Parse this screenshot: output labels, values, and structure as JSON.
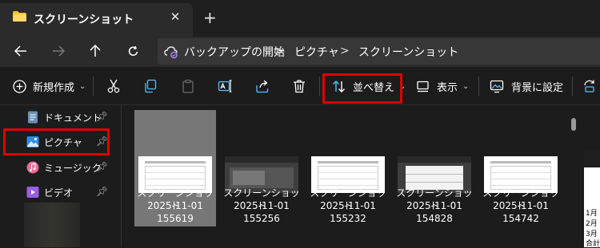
{
  "window": {
    "tab_title": "スクリーンショット",
    "close_symbol": "✕",
    "new_tab_symbol": "+"
  },
  "address_bar": {
    "breadcrumbs": [
      "バックアップの開始",
      "ピクチャ",
      "スクリーンショット"
    ],
    "separator": ">"
  },
  "command_bar": {
    "new_label": "新規作成",
    "sort_label": "並べ替え",
    "view_label": "表示",
    "set_background_label": "背景に設定"
  },
  "sidebar": {
    "items": [
      {
        "label": "ドキュメント",
        "icon": "document-icon"
      },
      {
        "label": "ピクチャ",
        "icon": "pictures-icon"
      },
      {
        "label": "ミュージック",
        "icon": "music-icon"
      },
      {
        "label": "ビデオ",
        "icon": "video-icon"
      }
    ]
  },
  "files": [
    {
      "name": "スクリーンショット",
      "date": "2025-11-01",
      "time": "155619",
      "selected": true
    },
    {
      "name": "スクリーンショット",
      "date": "2025-11-01",
      "time": "155256",
      "selected": false
    },
    {
      "name": "スクリーンショット",
      "date": "2025-11-01",
      "time": "155232",
      "selected": false
    },
    {
      "name": "スクリーンショット",
      "date": "2025-11-01",
      "time": "154828",
      "selected": false
    },
    {
      "name": "スクリーンショット",
      "date": "2025-11-01",
      "time": "154742",
      "selected": false
    }
  ],
  "edge_preview": {
    "rows": [
      "1月",
      "2月",
      "3月",
      "合計"
    ]
  },
  "colors": {
    "highlight": "#e00000",
    "accent": "#4cc2ff",
    "folder": "#f4c542"
  }
}
